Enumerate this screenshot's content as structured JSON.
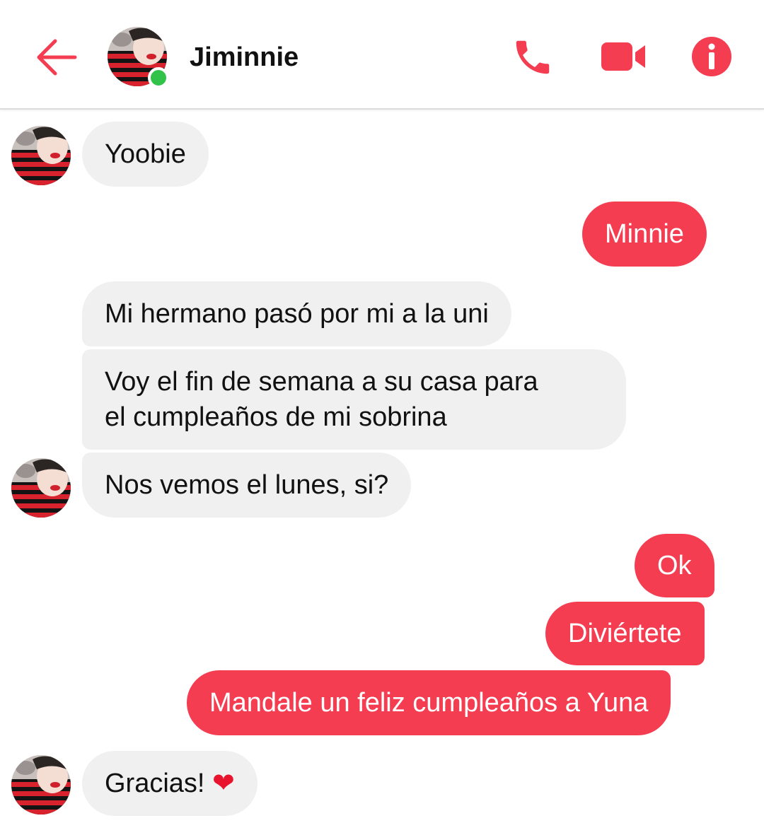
{
  "header": {
    "contact_name": "Jiminnie",
    "status": "online",
    "icons": [
      "back-arrow-icon",
      "phone-icon",
      "video-camera-icon",
      "info-icon"
    ]
  },
  "colors": {
    "accent": "#f53d52",
    "incoming_bubble": "#f0f0f0",
    "online": "#31c24a"
  },
  "messages": [
    {
      "sender": "Jiminnie",
      "direction": "incoming",
      "text": "Yoobie"
    },
    {
      "sender": "me",
      "direction": "outgoing",
      "text": "Minnie"
    },
    {
      "sender": "Jiminnie",
      "direction": "incoming",
      "text": "Mi hermano pasó por mi a la uni"
    },
    {
      "sender": "Jiminnie",
      "direction": "incoming",
      "lines": [
        "Voy el fin de semana a su casa para",
        "el cumpleaños de mi sobrina"
      ]
    },
    {
      "sender": "Jiminnie",
      "direction": "incoming",
      "text": "Nos vemos el lunes, si?"
    },
    {
      "sender": "me",
      "direction": "outgoing",
      "text": "Ok"
    },
    {
      "sender": "me",
      "direction": "outgoing",
      "text": "Diviértete"
    },
    {
      "sender": "me",
      "direction": "outgoing",
      "text": "Mandale un feliz cumpleaños a Yuna"
    },
    {
      "sender": "Jiminnie",
      "direction": "incoming",
      "text": "Gracias! ",
      "emoji": "❤"
    }
  ]
}
